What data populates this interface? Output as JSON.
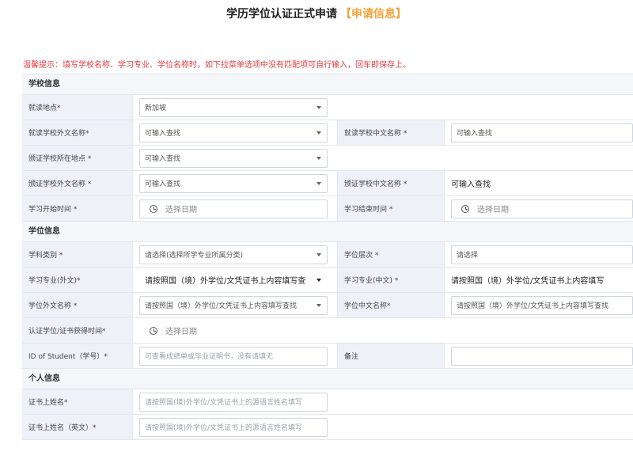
{
  "header": {
    "title": "学历学位认证正式申请",
    "tag": "【申请信息】"
  },
  "notice": "温馨提示：填写学校名称、学习专业、学位名称时，如下拉菜单选项中没有匹配项可自行输入，回车即保存上。",
  "sections": {
    "school": "学校信息",
    "degree": "学位信息",
    "personal": "个人信息"
  },
  "fields": {
    "study_location": {
      "label": "就读地点*",
      "value": "新加坡"
    },
    "school_foreign_name": {
      "label": "就读学校外文名称*",
      "placeholder": "可输入查找"
    },
    "school_chinese_name": {
      "label": "就读学校中文名称 *",
      "placeholder": "可输入查找"
    },
    "cert_school_location": {
      "label": "颁证学校所在地点 *",
      "placeholder": "可输入查找"
    },
    "cert_school_foreign_name": {
      "label": "颁证学校外文名称 *",
      "placeholder": "可输入查找"
    },
    "cert_school_chinese_name": {
      "label": "颁证学校中文名称 *",
      "value": "可输入查找"
    },
    "study_start": {
      "label": "学习开始时间 *",
      "placeholder": "选择日期"
    },
    "study_end": {
      "label": "学习结束时间 *",
      "placeholder": "选择日期"
    },
    "subject_category": {
      "label": "学科类别 *",
      "value": "请选择(选择所学专业所属分类)"
    },
    "degree_level": {
      "label": "学位层次 *",
      "value": "请选择"
    },
    "major_foreign": {
      "label": "学习专业(外文)*",
      "value": "请按照国（境）外学位/文凭证书上内容填写查"
    },
    "major_chinese": {
      "label": "学习专业(中文) *",
      "value": "请按照国（境）外学位/文凭证书上内容填写"
    },
    "degree_foreign_name": {
      "label": "学位外文名称 *",
      "value": "请按照国（境）外学位/文凭证书上内容填写查找"
    },
    "degree_chinese_name": {
      "label": "学位中文名称*",
      "value": "请按照国（境）外学位/文凭证书上内容填写查找"
    },
    "cert_obtained_time": {
      "label": "认证学位/证书获得时间*",
      "placeholder": "选择日期"
    },
    "student_id": {
      "label": "ID of Student（学号）*",
      "placeholder": "可查看成绩单或毕业证明书，没有请填无"
    },
    "remarks": {
      "label": "备注",
      "value": ""
    },
    "cert_surname": {
      "label": "证书上姓名*",
      "placeholder": "请按照国(境)外学位/文凭证书上的源语言姓名填写"
    },
    "cert_surname_en": {
      "label": "证书上姓名（英文）*",
      "placeholder": "请按照国(境)外学位/文凭证书上的源语言姓名填写"
    }
  }
}
